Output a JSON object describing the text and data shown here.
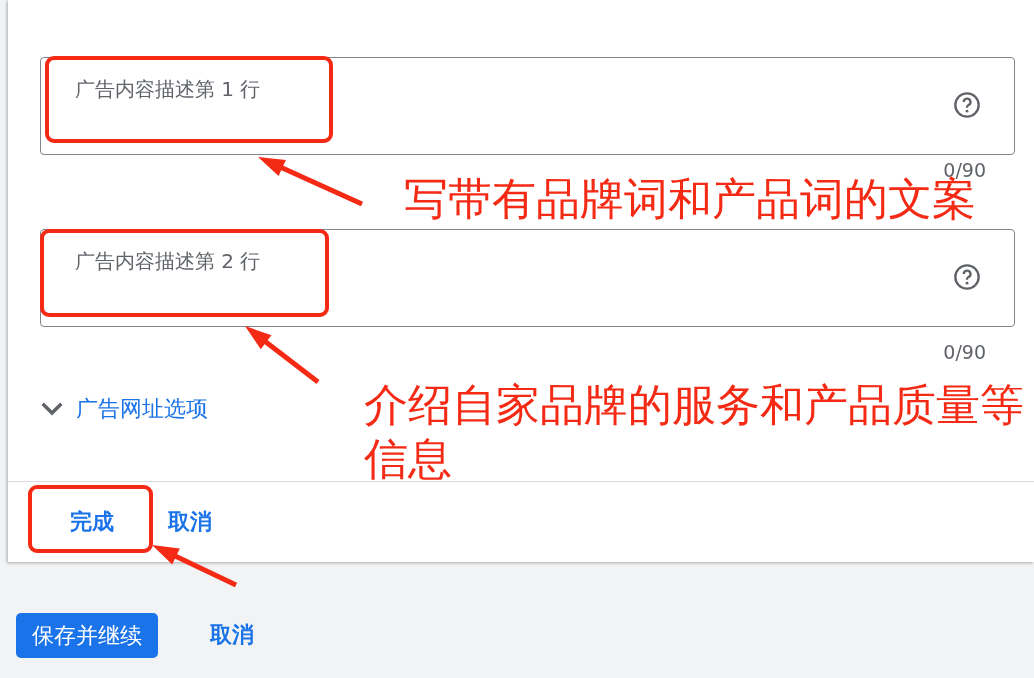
{
  "form": {
    "fields": [
      {
        "placeholder": "广告内容描述第 1 行",
        "counter": "0/90"
      },
      {
        "placeholder": "广告内容描述第 2 行",
        "counter": "0/90"
      }
    ],
    "url_options_link": "广告网址选项",
    "actions": [
      "完成",
      "取消"
    ]
  },
  "page_actions": [
    "保存并继续",
    "取消"
  ],
  "annotations": [
    {
      "text": "写带有品牌词和产品词的文案"
    },
    {
      "text": "介绍自家品牌的服务和产品质量等信息"
    }
  ]
}
